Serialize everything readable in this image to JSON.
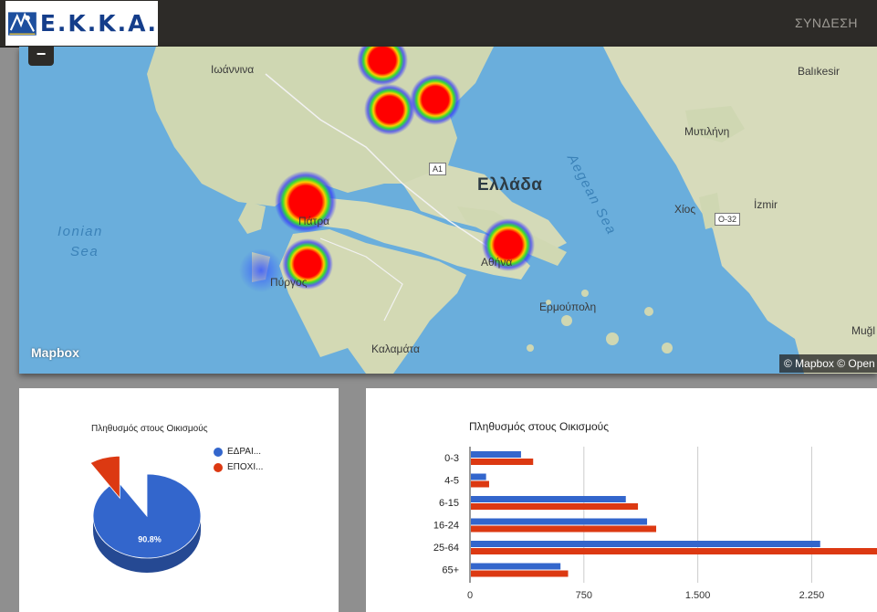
{
  "header": {
    "logo_text": "Ε.Κ.Κ.Α.",
    "login_label": "ΣΥΝΔΕΣΗ"
  },
  "map": {
    "zoom_out_label": "−",
    "place_labels": {
      "ioannina": "Ιωάννινα",
      "balikesir": "Balıkesir",
      "mytilini": "Μυτιλήνη",
      "chios": "Χίος",
      "izmir": "İzmir",
      "patra": "Πάτρα",
      "athina": "Αθήνα",
      "pyrgos": "Πύργος",
      "ermoupoli": "Ερμούπολη",
      "kalamata": "Καλαμάτα",
      "mugla": "Muğl"
    },
    "country_label": "Ελλάδα",
    "sea_labels": {
      "ionian": [
        "Ionian",
        "Sea"
      ],
      "aegean": "Aegean Sea"
    },
    "road_shields": {
      "a1": "A1",
      "o32": "O-32"
    },
    "logo": "Mapbox",
    "attribution": "© Mapbox © Open",
    "heat_colors": [
      "#ff0000",
      "#ffff00",
      "#00ff00",
      "#0000ff"
    ]
  },
  "pie_chart": {
    "chart_data": {
      "type": "pie",
      "title": "Πληθυσμός στους Οικισμούς",
      "slices": [
        {
          "name": "ΕΔΡΑΙ...",
          "value": 90.8,
          "color": "#3366cc",
          "label": "90.8%"
        },
        {
          "name": "ΕΠΟΧΙ...",
          "value": 9.2,
          "color": "#dc3912"
        }
      ],
      "legend": "right",
      "style": "3d"
    }
  },
  "bar_chart": {
    "chart_data": {
      "type": "bar",
      "orientation": "horizontal",
      "title": "Πληθυσμός στους Οικισμούς",
      "categories": [
        "0-3",
        "4-5",
        "6-15",
        "16-24",
        "25-64",
        "65+"
      ],
      "series": [
        {
          "values": [
            330,
            100,
            1020,
            1160,
            2300,
            590
          ],
          "color": "#3366cc"
        },
        {
          "values": [
            410,
            120,
            1100,
            1220,
            2680,
            640
          ],
          "color": "#dc3912"
        }
      ],
      "x_ticks": [
        "0",
        "750",
        "1.500",
        "2.250"
      ],
      "xlim": [
        0,
        2680
      ],
      "grid": true
    }
  }
}
